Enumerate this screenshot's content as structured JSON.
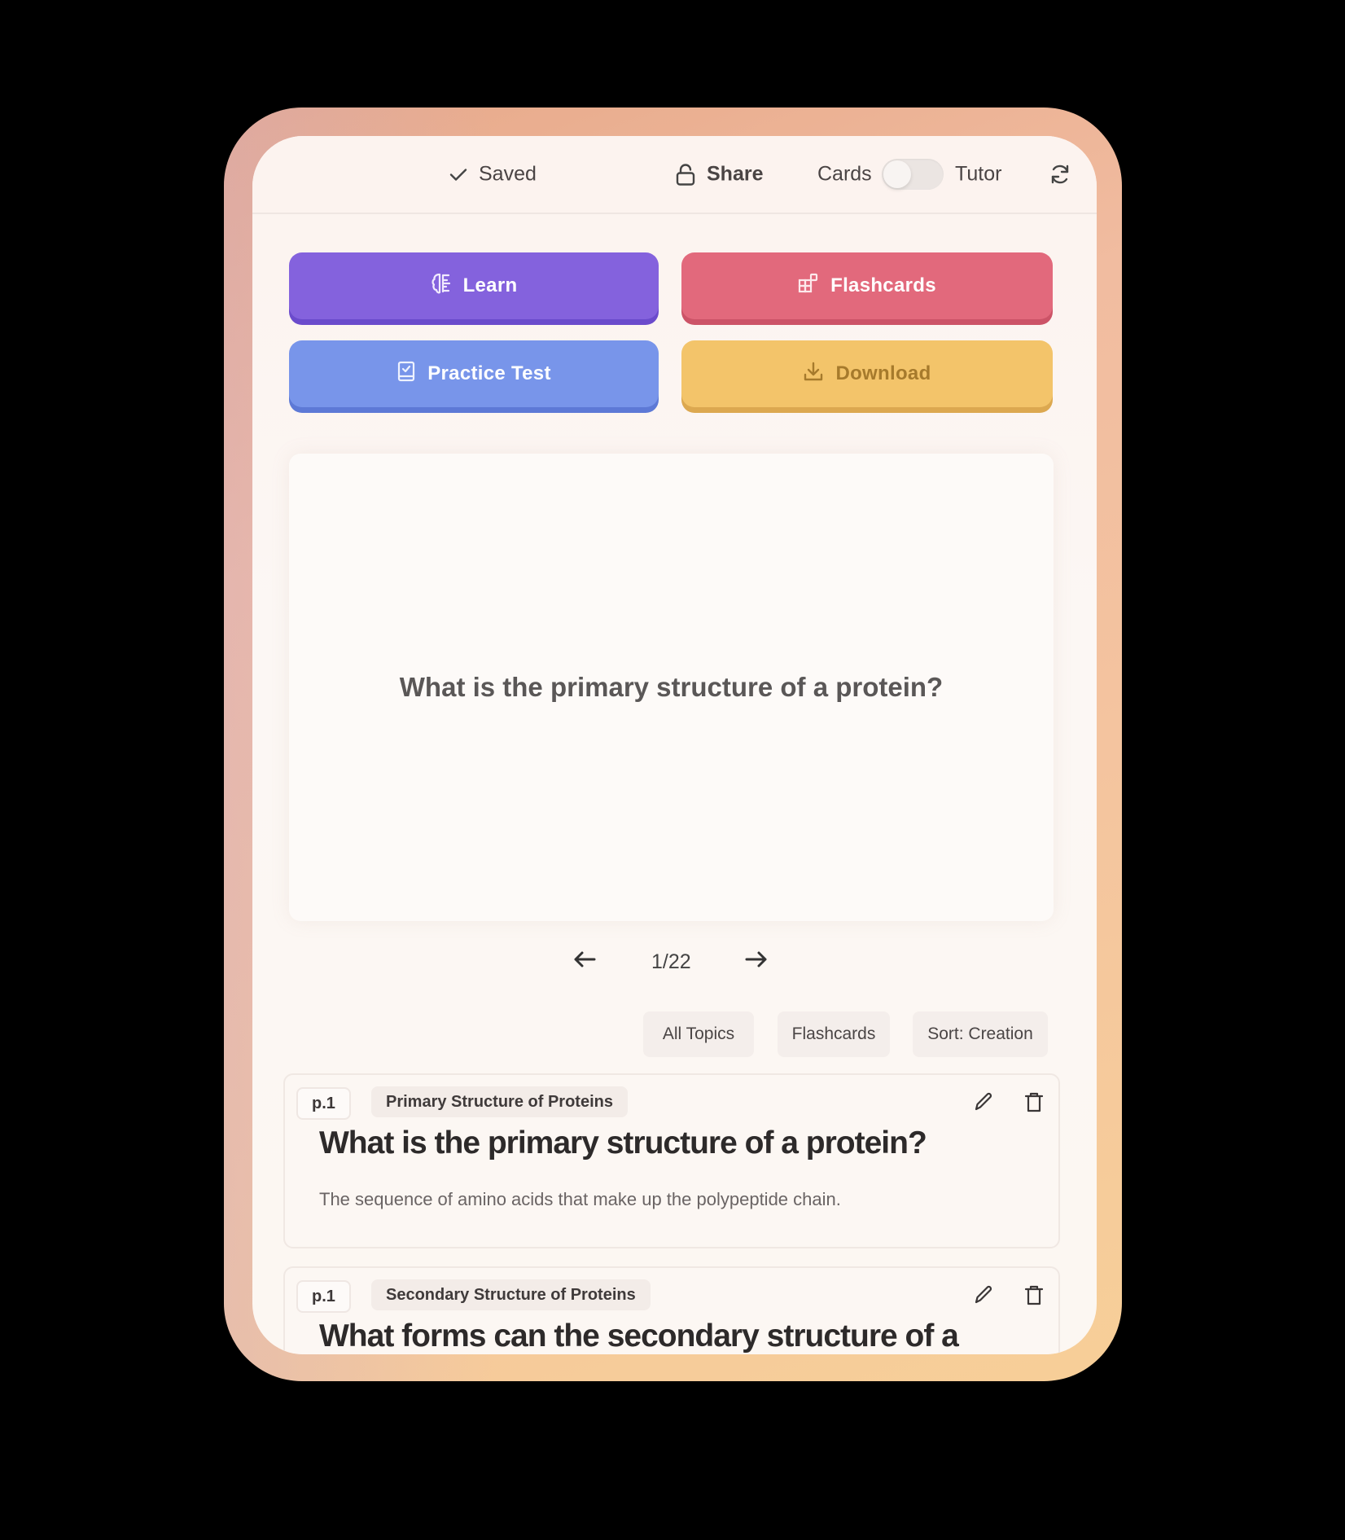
{
  "header": {
    "saved_label": "Saved",
    "share_label": "Share",
    "mode_left_label": "Cards",
    "mode_right_label": "Tutor",
    "mode_toggle_on": false
  },
  "actions": {
    "learn": {
      "label": "Learn",
      "icon": "brain-icon",
      "color": "#8462dd"
    },
    "flashcards": {
      "label": "Flashcards",
      "icon": "blocks-icon",
      "color": "#e2697c"
    },
    "practice_test": {
      "label": "Practice Test",
      "icon": "clipboard-check-icon",
      "color": "#7895ea"
    },
    "download": {
      "label": "Download",
      "icon": "download-icon",
      "color": "#f3c46a"
    }
  },
  "flashcard": {
    "question": "What is the primary structure of a protein?"
  },
  "pager": {
    "current": 1,
    "total": 22,
    "label": "1/22"
  },
  "filters": {
    "topics": "All Topics",
    "type": "Flashcards",
    "sort": "Sort: Creation"
  },
  "cards": [
    {
      "page": "p.1",
      "topic": "Primary Structure of Proteins",
      "question": "What is the primary structure of a protein?",
      "answer": "The sequence of amino acids that make up the polypeptide chain."
    },
    {
      "page": "p.1",
      "topic": "Secondary Structure of Proteins",
      "question": "What forms can the secondary structure of a"
    }
  ]
}
